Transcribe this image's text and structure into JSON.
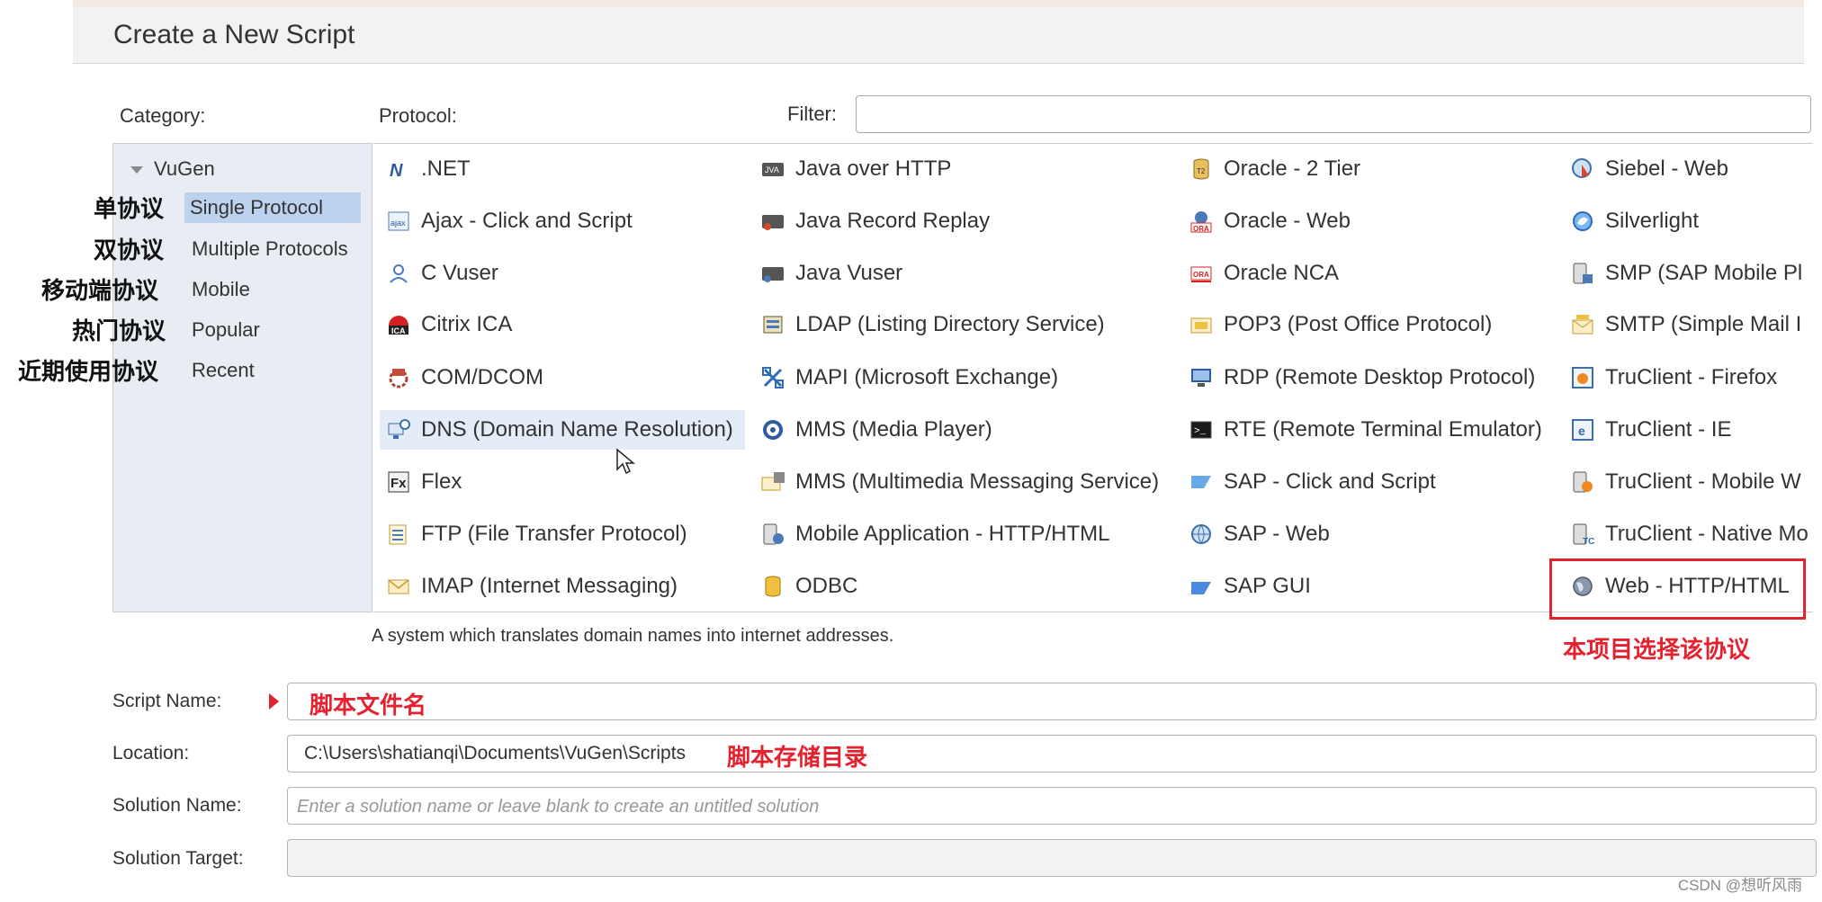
{
  "dialog": {
    "title": "Create a New Script"
  },
  "labels": {
    "category": "Category:",
    "protocol": "Protocol:",
    "filter": "Filter:"
  },
  "filter": {
    "value": ""
  },
  "category": {
    "root": "VuGen",
    "items": [
      {
        "label": "Single Protocol",
        "selected": true
      },
      {
        "label": "Multiple Protocols"
      },
      {
        "label": "Mobile"
      },
      {
        "label": "Popular"
      },
      {
        "label": "Recent"
      }
    ],
    "annotations": [
      "单协议",
      "双协议",
      "移动端协议",
      "热门协议",
      "近期使用协议"
    ]
  },
  "protocols": {
    "col1": [
      {
        "label": ".NET",
        "icon": "dotnet-icon"
      },
      {
        "label": "Ajax - Click and Script",
        "icon": "ajax-icon"
      },
      {
        "label": "C Vuser",
        "icon": "user-icon"
      },
      {
        "label": "Citrix ICA",
        "icon": "citrix-icon"
      },
      {
        "label": "COM/DCOM",
        "icon": "com-icon"
      },
      {
        "label": "DNS (Domain Name Resolution)",
        "icon": "dns-icon",
        "highlighted": true
      },
      {
        "label": "Flex",
        "icon": "flex-icon"
      },
      {
        "label": "FTP (File Transfer Protocol)",
        "icon": "ftp-icon"
      },
      {
        "label": "IMAP (Internet Messaging)",
        "icon": "mail-icon"
      }
    ],
    "col2": [
      {
        "label": "Java over HTTP",
        "icon": "java-icon"
      },
      {
        "label": "Java Record Replay",
        "icon": "java-icon"
      },
      {
        "label": "Java Vuser",
        "icon": "java-icon"
      },
      {
        "label": "LDAP (Listing Directory Service)",
        "icon": "ldap-icon"
      },
      {
        "label": "MAPI (Microsoft Exchange)",
        "icon": "mapi-icon"
      },
      {
        "label": "MMS (Media Player)",
        "icon": "media-player-icon"
      },
      {
        "label": "MMS (Multimedia Messaging Service)",
        "icon": "mms-icon"
      },
      {
        "label": "Mobile Application - HTTP/HTML",
        "icon": "mobile-icon"
      },
      {
        "label": "ODBC",
        "icon": "database-icon"
      }
    ],
    "col3": [
      {
        "label": "Oracle - 2 Tier",
        "icon": "oracle-icon"
      },
      {
        "label": "Oracle - Web",
        "icon": "oracle-web-icon"
      },
      {
        "label": "Oracle NCA",
        "icon": "oracle-nca-icon"
      },
      {
        "label": "POP3 (Post Office Protocol)",
        "icon": "pop3-icon"
      },
      {
        "label": "RDP (Remote Desktop Protocol)",
        "icon": "rdp-icon"
      },
      {
        "label": "RTE (Remote Terminal Emulator)",
        "icon": "terminal-icon"
      },
      {
        "label": "SAP - Click and Script",
        "icon": "sap-icon"
      },
      {
        "label": "SAP - Web",
        "icon": "sap-web-icon"
      },
      {
        "label": "SAP GUI",
        "icon": "sap-icon"
      }
    ],
    "col4": [
      {
        "label": "Siebel - Web",
        "icon": "siebel-icon"
      },
      {
        "label": "Silverlight",
        "icon": "silverlight-icon"
      },
      {
        "label": "SMP (SAP Mobile Pl",
        "icon": "smp-icon"
      },
      {
        "label": "SMTP (Simple Mail I",
        "icon": "smtp-icon"
      },
      {
        "label": "TruClient - Firefox",
        "icon": "truclient-icon"
      },
      {
        "label": "TruClient - IE",
        "icon": "truclient-icon"
      },
      {
        "label": "TruClient - Mobile W",
        "icon": "truclient-mobile-icon"
      },
      {
        "label": "TruClient - Native Mo",
        "icon": "truclient-native-icon"
      },
      {
        "label": "Web - HTTP/HTML",
        "icon": "globe-icon",
        "boxed": true
      }
    ]
  },
  "description": "A system which translates domain names into internet addresses.",
  "annotations": {
    "web_protocol": "本项目选择该协议",
    "script_name": "脚本文件名",
    "location": "脚本存储目录"
  },
  "form": {
    "script_name_label": "Script Name:",
    "script_name_value": "",
    "location_label": "Location:",
    "location_value": "C:\\Users\\shatianqi\\Documents\\VuGen\\Scripts",
    "solution_name_label": "Solution Name:",
    "solution_name_placeholder": "Enter a solution name or leave blank to create an untitled solution",
    "solution_target_label": "Solution Target:"
  },
  "watermark": "CSDN @想听风雨",
  "colors": {
    "accent_red": "#e3212f",
    "selection": "#bcd2ee",
    "panel": "#e8edf3"
  }
}
